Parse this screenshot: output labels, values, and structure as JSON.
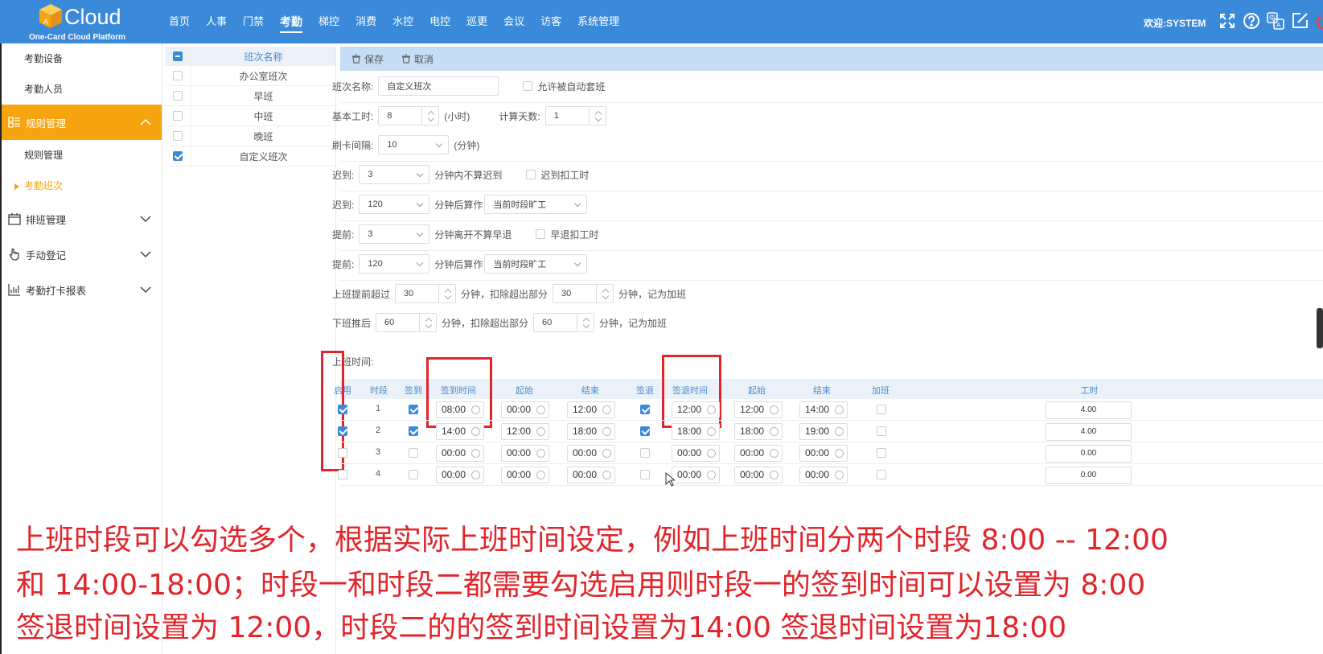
{
  "app": {
    "logo_text": "Cloud",
    "logo_sub": "One-Card Cloud Platform"
  },
  "nav": [
    "首页",
    "人事",
    "门禁",
    "考勤",
    "梯控",
    "消费",
    "水控",
    "电控",
    "巡更",
    "会议",
    "访客",
    "系统管理"
  ],
  "nav_active": "考勤",
  "header": {
    "welcome": "欢迎:SYSTEM",
    "icons": [
      "fullscreen-icon",
      "help-icon",
      "translate-icon",
      "edit-icon",
      "power-icon"
    ]
  },
  "sidebar": {
    "top_items": [
      "考勤设备",
      "考勤人员"
    ],
    "active_group": "规则管理",
    "active_sub": "规则管理",
    "current": "考勤班次",
    "groups": [
      "排班管理",
      "手动登记",
      "考勤打卡报表"
    ]
  },
  "shiftlist": {
    "header": "班次名称",
    "rows": [
      {
        "name": "办公室班次",
        "checked": false
      },
      {
        "name": "早班",
        "checked": false
      },
      {
        "name": "中班",
        "checked": false
      },
      {
        "name": "晚班",
        "checked": false
      },
      {
        "name": "自定义班次",
        "checked": true
      }
    ]
  },
  "toolbar": {
    "save": "保存",
    "cancel": "取消"
  },
  "form": {
    "shift_name_label": "班次名称:",
    "shift_name_value": "自定义班次",
    "allow_auto_label": "允许被自动套班",
    "base_hours_label": "基本工时:",
    "base_hours_value": "8",
    "hours_unit": "(小时)",
    "calc_days_label": "计算天数:",
    "calc_days_value": "1",
    "swipe_interval_label": "刷卡间隔:",
    "swipe_interval_value": "10",
    "minute_unit": "(分钟)",
    "late1_label": "迟到:",
    "late1_value": "3",
    "late1_text": "分钟内不算迟到",
    "late1_check": "迟到扣工时",
    "late2_label": "迟到:",
    "late2_value": "120",
    "late2_text": "分钟后算作",
    "late2_select": "当前时段旷工",
    "early1_label": "提前:",
    "early1_value": "3",
    "early1_text": "分钟离开不算早退",
    "early1_check": "早退扣工时",
    "early2_label": "提前:",
    "early2_value": "120",
    "early2_text": "分钟后算作",
    "early2_select": "当前时段旷工",
    "ot_before_label": "上班提前超过",
    "ot_before_value": "30",
    "ot_before_text": "分钟，扣除超出部分",
    "ot_before_value2": "30",
    "ot_before_text2": "分钟，记为加班",
    "ot_after_label": "下班推后",
    "ot_after_value": "60",
    "ot_after_text": "分钟，扣除超出部分",
    "ot_after_value2": "60",
    "ot_after_text2": "分钟，记为加班",
    "work_time_label": "上班时间:"
  },
  "grid": {
    "headers": [
      "启用",
      "时段",
      "签到",
      "签到时间",
      "起始",
      "结束",
      "签退",
      "签退时间",
      "起始",
      "结束",
      "加班",
      "工时"
    ],
    "rows": [
      {
        "enabled": true,
        "period": "1",
        "checkin": true,
        "in_time": "08:00",
        "in_start": "00:00",
        "in_end": "12:00",
        "checkout": true,
        "out_time": "12:00",
        "out_start": "12:00",
        "out_end": "14:00",
        "ot": false,
        "hours": "4.00"
      },
      {
        "enabled": true,
        "period": "2",
        "checkin": true,
        "in_time": "14:00",
        "in_start": "12:00",
        "in_end": "18:00",
        "checkout": true,
        "out_time": "18:00",
        "out_start": "18:00",
        "out_end": "19:00",
        "ot": false,
        "hours": "4.00"
      },
      {
        "enabled": false,
        "period": "3",
        "checkin": false,
        "in_time": "00:00",
        "in_start": "00:00",
        "in_end": "00:00",
        "checkout": false,
        "out_time": "00:00",
        "out_start": "00:00",
        "out_end": "00:00",
        "ot": false,
        "hours": "0.00"
      },
      {
        "enabled": false,
        "period": "4",
        "checkin": false,
        "in_time": "00:00",
        "in_start": "00:00",
        "in_end": "00:00",
        "checkout": false,
        "out_time": "00:00",
        "out_start": "00:00",
        "out_end": "00:00",
        "ot": false,
        "hours": "0.00"
      }
    ]
  },
  "caption": [
    "上班时段可以勾选多个，根据实际上班时间设定，例如上班时间分两个时段 8:00 -- 12:00",
    "和  14:00-18:00；时段一和时段二都需要勾选启用则时段一的签到时间可以设置为 8:00",
    "签退时间设置为 12:00，时段二的的签到时间设置为14:00 签退时间设置为18:00"
  ],
  "colors": {
    "primary": "#3b8ad9",
    "accent": "#f7a50f",
    "annotation": "#e0252b"
  }
}
